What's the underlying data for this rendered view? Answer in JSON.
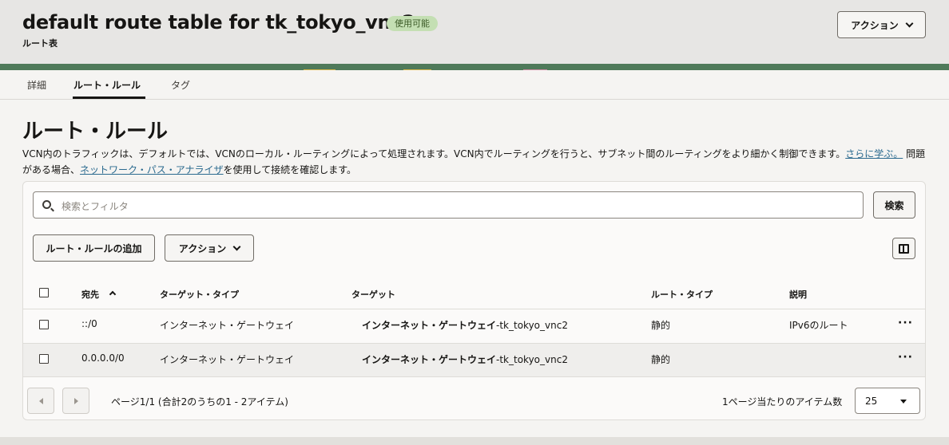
{
  "header": {
    "title": "default route table for tk_tokyo_vnc2",
    "status_badge": "使用可能",
    "subtitle": "ルート表",
    "actions_label": "アクション"
  },
  "tabs": [
    {
      "label": "詳細"
    },
    {
      "label": "ルート・ルール"
    },
    {
      "label": "タグ"
    }
  ],
  "section": {
    "title": "ルート・ルール",
    "desc_part1": "VCN内のトラフィックは、デフォルトでは、VCNのローカル・ルーティングによって処理されます。VCN内でルーティングを行うと、サブネット間のルーティングをより細かく制御できます。",
    "learn_more": "さらに学ぶ。",
    "desc_part2": " 問題がある場合、",
    "analyzer_link": "ネットワーク・パス・アナライザ",
    "desc_part3": "を使用して接続を確認します。"
  },
  "search": {
    "placeholder": "検索とフィルタ",
    "button": "検索"
  },
  "toolbar": {
    "add_rule": "ルート・ルールの追加",
    "actions": "アクション"
  },
  "table": {
    "columns": [
      "宛先",
      "ターゲット・タイプ",
      "ターゲット",
      "ルート・タイプ",
      "説明"
    ],
    "rows": [
      {
        "destination": "::/0",
        "target_type": "インターネット・ゲートウェイ",
        "target_bold": "インターネット・ゲートウェイ",
        "target_suffix": "-tk_tokyo_vnc2",
        "route_type": "静的",
        "description": "IPv6のルート"
      },
      {
        "destination": "0.0.0.0/0",
        "target_type": "インターネット・ゲートウェイ",
        "target_bold": "インターネット・ゲートウェイ",
        "target_suffix": "-tk_tokyo_vnc2",
        "route_type": "静的",
        "description": ""
      }
    ],
    "row_menu": "···"
  },
  "pagination": {
    "summary": "ページ1/1 (合計2のうちの1 - 2アイテム)",
    "per_page_label": "1ページ当たりのアイテム数",
    "per_page_value": "25"
  },
  "colors": {
    "badge_bg": "#c4dfb3",
    "link": "#2b6a8f",
    "banner_green": "#4f7a5a"
  }
}
